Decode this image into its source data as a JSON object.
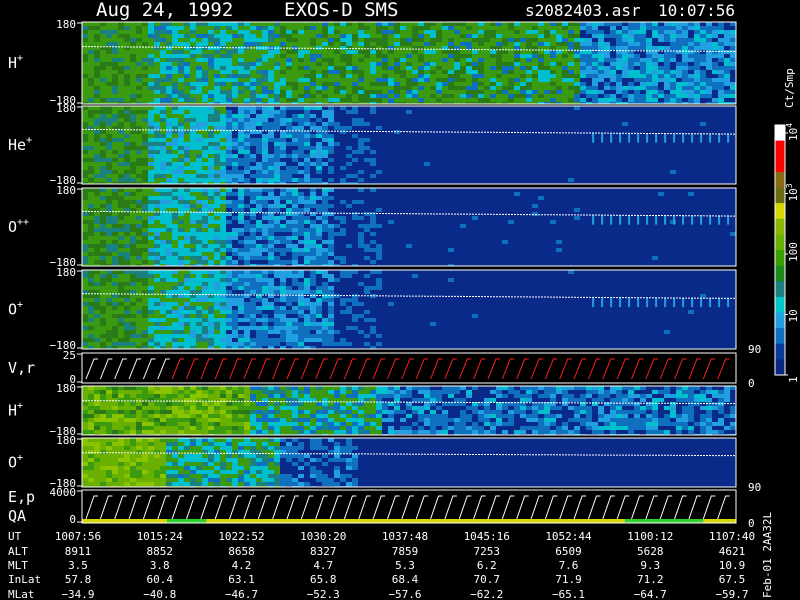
{
  "header": {
    "date": "Aug 24, 1992",
    "instrument": "EXOS-D SMS",
    "file": "s2082403.asr",
    "time": "10:07:56"
  },
  "colorbar": {
    "unit": "Ct/Smp",
    "labels": [
      {
        "value": 10000,
        "text": "10"
      },
      {
        "value": 1000,
        "text": "10"
      },
      {
        "value": 100,
        "text": "100"
      },
      {
        "value": 10,
        "text": "10"
      },
      {
        "value": 1,
        "text": "1"
      }
    ],
    "exponents": {
      "0": "4",
      "1": "3"
    },
    "colors": [
      "#ffffff",
      "#ff0000",
      "#ff0000",
      "#8b6914",
      "#6b6b10",
      "#d7d700",
      "#8ab800",
      "#6ab000",
      "#3aa000",
      "#1a8a1a",
      "#1a8080",
      "#00c8c8",
      "#20a0e0",
      "#1070c0",
      "#0a3a9a",
      "#0a2880"
    ]
  },
  "chart_data": [
    {
      "type": "heatmap",
      "panel": "H+",
      "label": "H",
      "sup": "+",
      "ylim": [
        -180,
        180
      ],
      "ytick_top": "180",
      "ytick_bottom": "−180",
      "profile": "h1"
    },
    {
      "type": "heatmap",
      "panel": "He+",
      "label": "He",
      "sup": "+",
      "ylim": [
        -180,
        180
      ],
      "ytick_top": "180",
      "ytick_bottom": "−180",
      "profile": "he"
    },
    {
      "type": "heatmap",
      "panel": "O++",
      "label": "O",
      "sup": "++",
      "ylim": [
        -180,
        180
      ],
      "ytick_top": "180",
      "ytick_bottom": "−180",
      "profile": "o2"
    },
    {
      "type": "heatmap",
      "panel": "O+",
      "label": "O",
      "sup": "+",
      "ylim": [
        -180,
        180
      ],
      "ytick_top": "180",
      "ytick_bottom": "−180",
      "profile": "o1",
      "right_tick": "90"
    },
    {
      "type": "line",
      "panel": "V,r",
      "label": "V,r",
      "ylim": [
        0,
        25
      ],
      "ytick_top": "25",
      "ytick_bottom": "0",
      "right_tick": "0"
    },
    {
      "type": "heatmap",
      "panel": "H+ (2)",
      "label": "H",
      "sup": "+",
      "ylim": [
        -180,
        180
      ],
      "ytick_top": "180",
      "ytick_bottom": "−180",
      "profile": "h2"
    },
    {
      "type": "heatmap",
      "panel": "O+ (2)",
      "label": "O",
      "sup": "+",
      "ylim": [
        -180,
        180
      ],
      "ytick_top": "180",
      "ytick_bottom": "−180",
      "profile": "o3",
      "right_tick": "90"
    },
    {
      "type": "line",
      "panel": "E,p",
      "label": "E,p",
      "label2": "QA",
      "ylim": [
        0,
        4000
      ],
      "ytick_top": "4000",
      "ytick_bottom": "0",
      "right_tick": "0"
    }
  ],
  "side_text": "Feb-01 2AA32L",
  "table": {
    "rows": [
      {
        "label": "UT",
        "values": [
          "1007:56",
          "1015:24",
          "1022:52",
          "1030:20",
          "1037:48",
          "1045:16",
          "1052:44",
          "1100:12",
          "1107:40"
        ]
      },
      {
        "label": "ALT",
        "values": [
          "8911",
          "8852",
          "8658",
          "8327",
          "7859",
          "7253",
          "6509",
          "5628",
          "4621"
        ]
      },
      {
        "label": "MLT",
        "values": [
          "3.5",
          "3.8",
          "4.2",
          "4.7",
          "5.3",
          "6.2",
          "7.6",
          "9.3",
          "10.9"
        ]
      },
      {
        "label": "InLat",
        "values": [
          "57.8",
          "60.4",
          "63.1",
          "65.8",
          "68.4",
          "70.7",
          "71.9",
          "71.2",
          "67.5"
        ]
      },
      {
        "label": "MLat",
        "values": [
          "−34.9",
          "−40.8",
          "−46.7",
          "−52.3",
          "−57.6",
          "−62.2",
          "−65.1",
          "−64.7",
          "−59.7"
        ]
      }
    ]
  }
}
